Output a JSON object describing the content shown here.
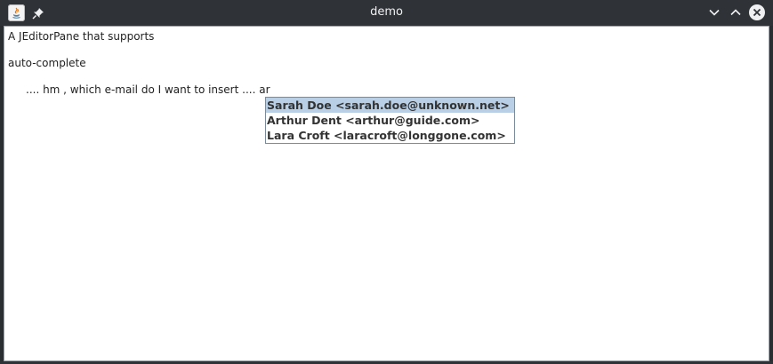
{
  "window": {
    "title": "demo",
    "icons": {
      "app": "java-app-icon",
      "pin": "pin-icon",
      "minimize": "chevron-down-icon",
      "maximize": "chevron-up-icon",
      "close": "close-icon"
    }
  },
  "editor": {
    "line1": "A JEditorPane that supports",
    "line2": "auto-complete",
    "line3_prefix": ".... hm , which e-mail do I want to insert ....",
    "line3_typed": "ar"
  },
  "autocomplete": {
    "selected_index": 0,
    "items": [
      "Sarah Doe <sarah.doe@unknown.net>",
      "Arthur Dent <arthur@guide.com>",
      "Lara Croft <laracroft@longgone.com>"
    ]
  },
  "colors": {
    "titlebar": "#2f3236",
    "selection": "#b8cfe5",
    "editor_bg": "#ffffff"
  }
}
